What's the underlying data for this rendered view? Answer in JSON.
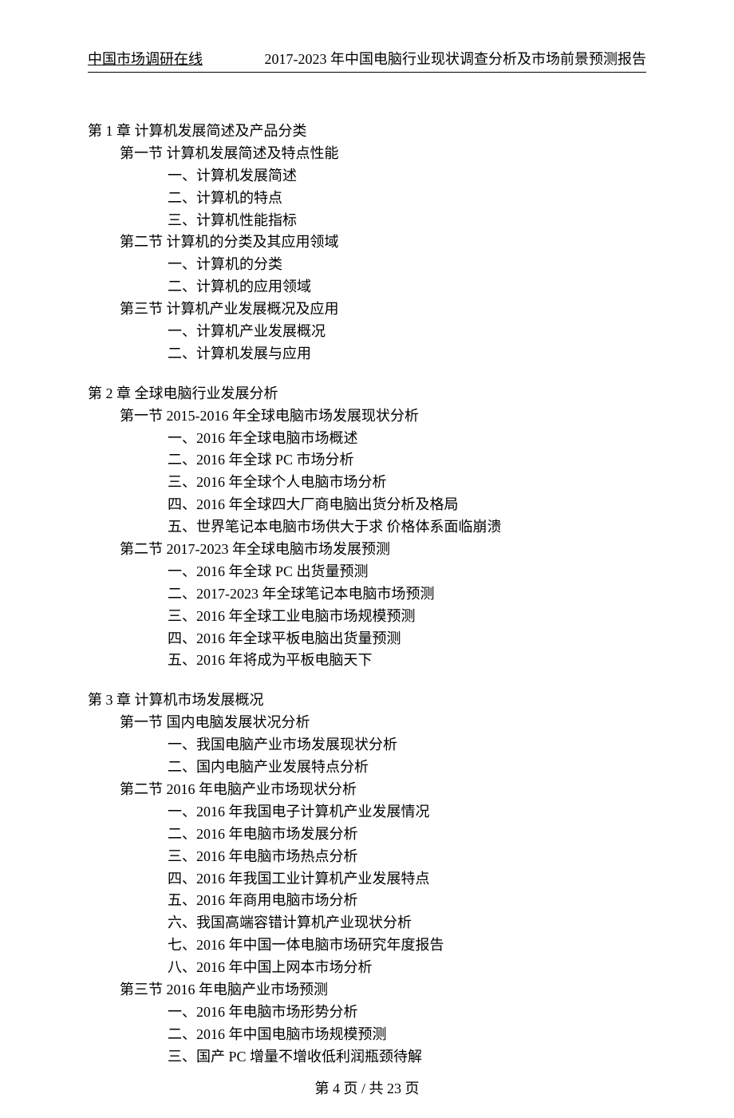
{
  "header": {
    "left": "中国市场调研在线",
    "right": "2017-2023 年中国电脑行业现状调查分析及市场前景预测报告"
  },
  "chapters": [
    {
      "title": "第 1 章   计算机发展简述及产品分类",
      "sections": [
        {
          "title": "第一节 计算机发展简述及特点性能",
          "items": [
            "一、计算机发展简述",
            "二、计算机的特点",
            "三、计算机性能指标"
          ]
        },
        {
          "title": "第二节 计算机的分类及其应用领域",
          "items": [
            "一、计算机的分类",
            "二、计算机的应用领域"
          ]
        },
        {
          "title": "第三节 计算机产业发展概况及应用",
          "items": [
            "一、计算机产业发展概况",
            "二、计算机发展与应用"
          ]
        }
      ]
    },
    {
      "title": "第 2 章    全球电脑行业发展分析",
      "sections": [
        {
          "title": "第一节 2015-2016 年全球电脑市场发展现状分析",
          "items": [
            "一、2016 年全球电脑市场概述",
            "二、2016 年全球 PC 市场分析",
            "三、2016 年全球个人电脑市场分析",
            "四、2016 年全球四大厂商电脑出货分析及格局",
            "五、世界笔记本电脑市场供大于求 价格体系面临崩溃"
          ]
        },
        {
          "title": "第二节 2017-2023 年全球电脑市场发展预测",
          "items": [
            "一、2016 年全球 PC 出货量预测",
            "二、2017-2023 年全球笔记本电脑市场预测",
            "三、2016 年全球工业电脑市场规模预测",
            "四、2016 年全球平板电脑出货量预测",
            "五、2016 年将成为平板电脑天下"
          ]
        }
      ]
    },
    {
      "title": "第 3 章    计算机市场发展概况",
      "sections": [
        {
          "title": "第一节 国内电脑发展状况分析",
          "items": [
            "一、我国电脑产业市场发展现状分析",
            "二、国内电脑产业发展特点分析"
          ]
        },
        {
          "title": "第二节 2016 年电脑产业市场现状分析",
          "items": [
            "一、2016 年我国电子计算机产业发展情况",
            "二、2016 年电脑市场发展分析",
            "三、2016 年电脑市场热点分析",
            "四、2016 年我国工业计算机产业发展特点",
            "五、2016 年商用电脑市场分析",
            "六、我国高端容错计算机产业现状分析",
            "七、2016 年中国一体电脑市场研究年度报告",
            "八、2016 年中国上网本市场分析"
          ]
        },
        {
          "title": "第三节 2016 年电脑产业市场预测",
          "items": [
            "一、2016 年电脑市场形势分析",
            "二、2016 年中国电脑市场规模预测",
            "三、国产 PC 增量不增收低利润瓶颈待解"
          ]
        }
      ]
    }
  ],
  "footer": "第 4 页 / 共 23 页"
}
